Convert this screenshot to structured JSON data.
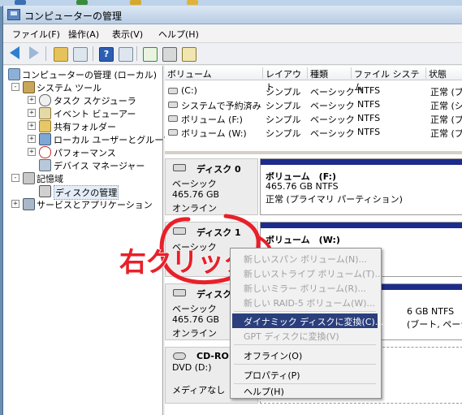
{
  "window": {
    "title": "コンピューターの管理"
  },
  "menubar": {
    "items": [
      "ファイル(F)",
      "操作(A)",
      "表示(V)",
      "ヘルプ(H)"
    ]
  },
  "toolbar": {
    "icons": [
      "back-arrow-icon",
      "forward-arrow-icon",
      "up-folder-icon",
      "show-hide-tree-icon",
      "help-icon",
      "action-pane-icon",
      "refresh-icon",
      "properties-icon",
      "export-icon"
    ]
  },
  "tree": {
    "root": "コンピューターの管理 (ローカル)",
    "system_tools": "システム ツール",
    "task_scheduler": "タスク スケジューラ",
    "event_viewer": "イベント ビューアー",
    "shared_folders": "共有フォルダー",
    "local_users": "ローカル ユーザーとグループ",
    "performance": "パフォーマンス",
    "device_manager": "デバイス マネージャー",
    "storage": "記憶域",
    "disk_management": "ディスクの管理",
    "services_apps": "サービスとアプリケーション",
    "expand_plus": "+",
    "collapse_minus": "-"
  },
  "volume_list": {
    "headers": [
      "ボリューム",
      "レイアウト",
      "種類",
      "ファイル システム",
      "状態"
    ],
    "rows": [
      {
        "volume": "(C:)",
        "layout": "シンプル",
        "type": "ベーシック",
        "fs": "NTFS",
        "status": "正常 (ブ"
      },
      {
        "volume": "システムで予約済み",
        "layout": "シンプル",
        "type": "ベーシック",
        "fs": "NTFS",
        "status": "正常 (シ"
      },
      {
        "volume": "ボリューム (F:)",
        "layout": "シンプル",
        "type": "ベーシック",
        "fs": "NTFS",
        "status": "正常 (プ"
      },
      {
        "volume": "ボリューム (W:)",
        "layout": "シンプル",
        "type": "ベーシック",
        "fs": "NTFS",
        "status": "正常 (プ"
      }
    ]
  },
  "disks": {
    "disk0": {
      "name": "ディスク 0",
      "kind": "ベーシック",
      "size": "465.76 GB",
      "status": "オンライン",
      "partition": {
        "title": "ボリューム　(F:)",
        "size": "465.76 GB NTFS",
        "status": "正常 (プライマリ パーティション)"
      }
    },
    "disk1": {
      "name": "ディスク 1",
      "kind": "ベーシック",
      "size": "465.76 GB",
      "status": "オンライン",
      "partition": {
        "title": "ボリューム　(W:)"
      }
    },
    "disk2": {
      "name": "ディスク",
      "kind": "ベーシック",
      "size": "465.76 GB",
      "status": "オンライン",
      "partition": {
        "size": "6 GB NTFS",
        "status": "(ブート, ページ ファイル"
      }
    },
    "cdrom": {
      "name": "CD-RO",
      "drive": "DVD (D:)",
      "status": "メディアなし"
    }
  },
  "context_menu": {
    "items": [
      {
        "label": "新しいスパン ボリューム(N)...",
        "enabled": false
      },
      {
        "label": "新しいストライプ ボリューム(T)...",
        "enabled": false
      },
      {
        "label": "新しいミラー ボリューム(R)...",
        "enabled": false
      },
      {
        "label": "新しい RAID-5 ボリューム(W)...",
        "enabled": false
      },
      {
        "label": "ダイナミック ディスクに変換(C)...",
        "enabled": true,
        "highlighted": true
      },
      {
        "label": "GPT ディスクに変換(V)",
        "enabled": false
      },
      {
        "label": "オフライン(O)",
        "enabled": true
      },
      {
        "label": "プロパティ(P)",
        "enabled": true
      },
      {
        "label": "ヘルプ(H)",
        "enabled": true
      }
    ]
  },
  "annotation": {
    "text": "右クリック",
    "color": "#e8202a"
  },
  "colors": {
    "partition_bar": "#1c2c8c",
    "menu_highlight": "#2a3f7c"
  }
}
